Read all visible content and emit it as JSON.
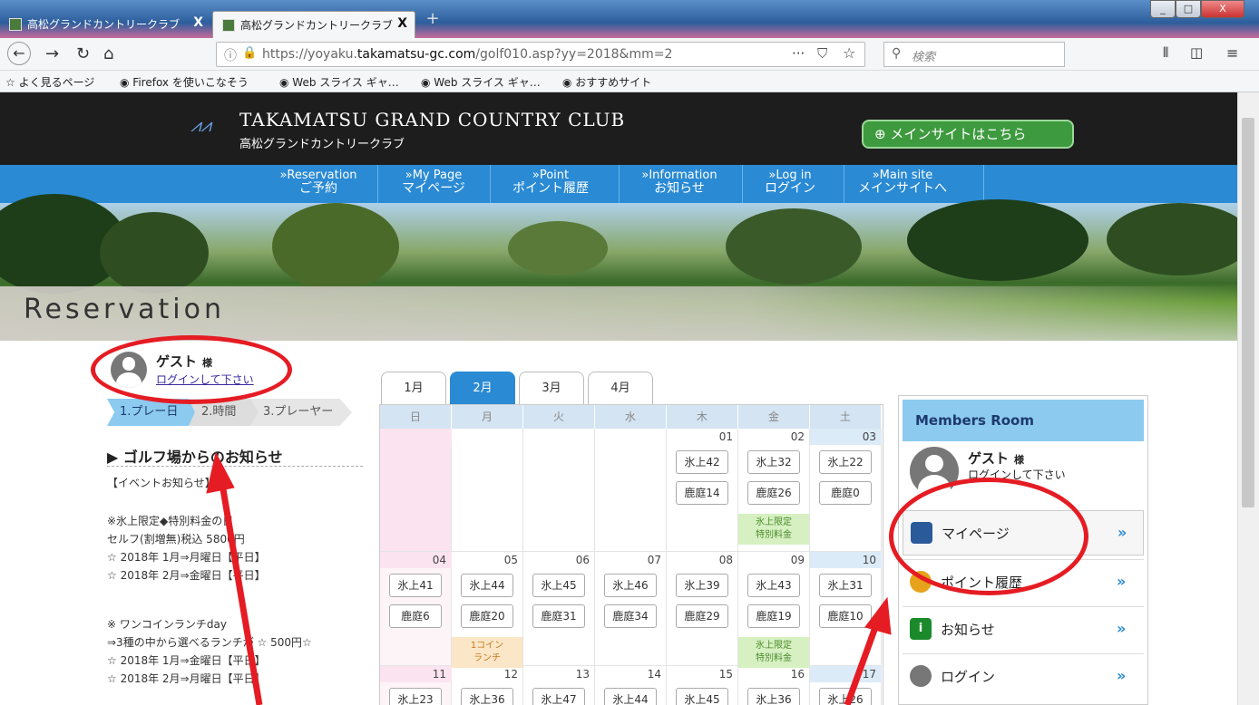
{
  "browser": {
    "tabs": [
      {
        "label": "高松グランドカントリークラブ",
        "active": false
      },
      {
        "label": "高松グランドカントリークラブ",
        "active": true
      }
    ],
    "close_label": "X",
    "new_tab": "+",
    "window_buttons": [
      "_",
      "□",
      "X"
    ],
    "url_prefix": "https://yoyaku.",
    "url_domain": "takamatsu-gc.com",
    "url_path": "/golf010.asp?yy=2018&mm=2",
    "url_more": "···",
    "search_placeholder": "検索",
    "nav_icons": [
      "back-icon",
      "forward-icon",
      "reload-icon",
      "home-icon"
    ],
    "bookmarks": [
      "よく見るページ",
      "Firefox を使いこなそう",
      "Web スライス ギャ…",
      "Web スライス ギャ…",
      "おすすめサイト"
    ]
  },
  "site": {
    "title": "TAKAMATSU GRAND COUNTRY CLUB",
    "subtitle": "高松グランドカントリークラブ",
    "main_site_button": "⊕ メインサイトはこちら",
    "menu": [
      {
        "en": "»Reservation",
        "jp": "ご予約"
      },
      {
        "en": "»My Page",
        "jp": "マイページ"
      },
      {
        "en": "»Point",
        "jp": "ポイント履歴"
      },
      {
        "en": "»Information",
        "jp": "お知らせ"
      },
      {
        "en": "»Log in",
        "jp": "ログイン"
      },
      {
        "en": "»Main site",
        "jp": "メインサイトへ"
      }
    ],
    "banner_title": "Reservation"
  },
  "left": {
    "guest_name": "ゲスト",
    "guest_honorific": "様",
    "login_prompt": "ログインして下さい",
    "steps": [
      "1.プレー日",
      "2.時間",
      "3.プレーヤー"
    ],
    "notice_title": "▶ ゴルフ場からのお知らせ",
    "notice_lines": [
      "【イベントお知らせ】",
      "",
      "※氷上限定◆特別料金の日",
      "セルフ(割増無)税込 5800円",
      "☆ 2018年 1月⇒月曜日【平日】",
      "☆ 2018年 2月⇒金曜日【平日】",
      "",
      "※ ワンコインランチday",
      "⇒3種の中から選べるランチが ☆ 500円☆",
      "☆ 2018年 1月⇒金曜日【平日】",
      "☆ 2018年 2月⇒月曜日【平日】"
    ]
  },
  "calendar": {
    "months": [
      "1月",
      "2月",
      "3月",
      "4月"
    ],
    "active_month": 1,
    "weekdays": [
      "日",
      "月",
      "火",
      "水",
      "木",
      "金",
      "土"
    ],
    "weeks": [
      [
        {
          "day": "",
          "buttons": []
        },
        {
          "day": "",
          "buttons": []
        },
        {
          "day": "",
          "buttons": []
        },
        {
          "day": "",
          "buttons": []
        },
        {
          "day": "01",
          "buttons": [
            "氷上42",
            "鹿庭14"
          ]
        },
        {
          "day": "02",
          "buttons": [
            "氷上32",
            "鹿庭26"
          ],
          "tag": "氷上限定\n特別料金"
        },
        {
          "day": "03",
          "buttons": [
            "氷上22",
            "鹿庭0"
          ]
        }
      ],
      [
        {
          "day": "04",
          "buttons": [
            "氷上41",
            "鹿庭6"
          ]
        },
        {
          "day": "05",
          "buttons": [
            "氷上44",
            "鹿庭20"
          ],
          "tag": "1コイン\nランチ"
        },
        {
          "day": "06",
          "buttons": [
            "氷上45",
            "鹿庭31"
          ]
        },
        {
          "day": "07",
          "buttons": [
            "氷上46",
            "鹿庭34"
          ]
        },
        {
          "day": "08",
          "buttons": [
            "氷上39",
            "鹿庭29"
          ]
        },
        {
          "day": "09",
          "buttons": [
            "氷上43",
            "鹿庭19"
          ],
          "tag": "氷上限定\n特別料金"
        },
        {
          "day": "10",
          "buttons": [
            "氷上31",
            "鹿庭10"
          ]
        }
      ],
      [
        {
          "day": "11",
          "buttons": [
            "氷上23"
          ]
        },
        {
          "day": "12",
          "buttons": [
            "氷上36"
          ]
        },
        {
          "day": "13",
          "buttons": [
            "氷上47"
          ]
        },
        {
          "day": "14",
          "buttons": [
            "氷上44"
          ]
        },
        {
          "day": "15",
          "buttons": [
            "氷上45"
          ]
        },
        {
          "day": "16",
          "buttons": [
            "氷上36"
          ]
        },
        {
          "day": "17",
          "buttons": [
            "氷上26"
          ]
        }
      ]
    ]
  },
  "members_room": {
    "title": "Members Room",
    "name": "ゲスト",
    "honorific": "様",
    "message": "ログインして下さい",
    "items": [
      {
        "label": "マイページ",
        "icon": "person-icon"
      },
      {
        "label": "ポイント履歴",
        "icon": "coin-icon"
      },
      {
        "label": "お知らせ",
        "icon": "info-icon"
      },
      {
        "label": "ログイン",
        "icon": "lock-icon"
      }
    ],
    "chevron": "»"
  },
  "colors": {
    "accent": "#2a8ad4",
    "header_bg": "#1d1d1d",
    "main_site_green": "#3e9a3e",
    "annotation_red": "#e51c23"
  }
}
